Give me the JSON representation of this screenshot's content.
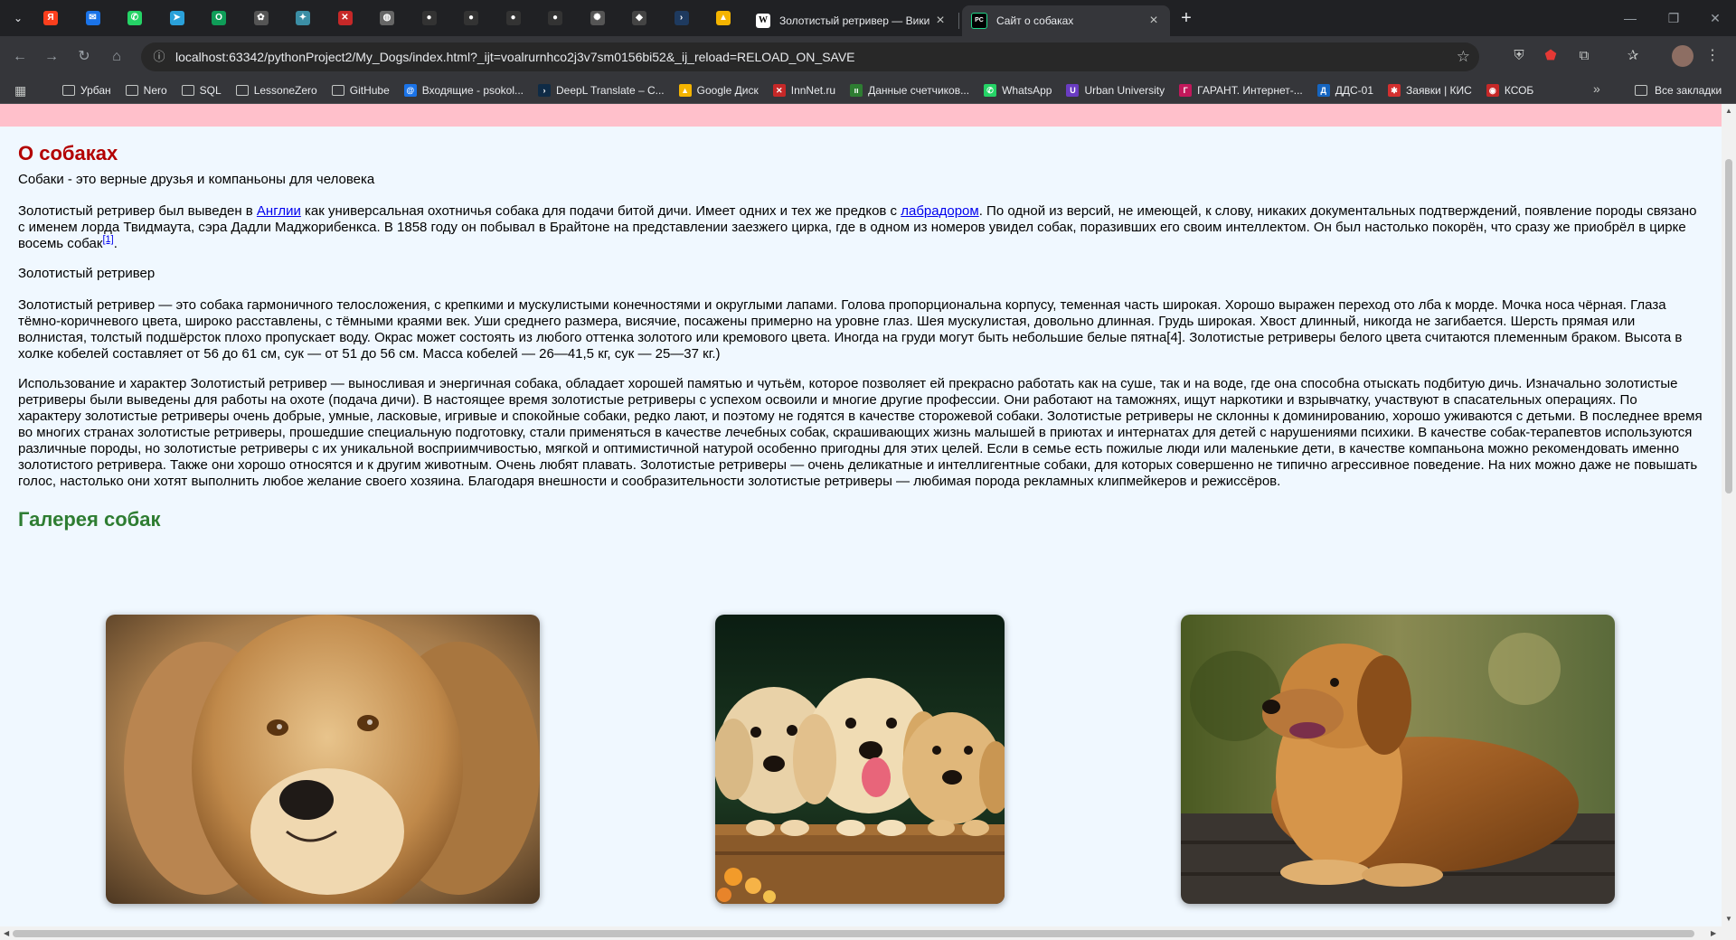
{
  "browser": {
    "pinned_tabs": [
      {
        "icon": "yandex-icon",
        "color": "#fc3f1d",
        "glyph": "Я"
      },
      {
        "icon": "mail-icon",
        "color": "#1a73e8",
        "glyph": "✉"
      },
      {
        "icon": "whatsapp-icon",
        "color": "#25d366",
        "glyph": "✆"
      },
      {
        "icon": "telegram-icon",
        "color": "#2aa1da",
        "glyph": "➤"
      },
      {
        "icon": "app-icon",
        "color": "#0f9d58",
        "glyph": "O"
      },
      {
        "icon": "plant-icon",
        "color": "#555555",
        "glyph": "✿"
      },
      {
        "icon": "puzzle-icon",
        "color": "#3b8ea5",
        "glyph": "✦"
      },
      {
        "icon": "innnet-icon",
        "color": "#c62828",
        "glyph": "✕"
      },
      {
        "icon": "globe-icon",
        "color": "#666666",
        "glyph": "◍"
      },
      {
        "icon": "github-icon",
        "color": "#333333",
        "glyph": "●"
      },
      {
        "icon": "github-icon",
        "color": "#333333",
        "glyph": "●"
      },
      {
        "icon": "github-icon",
        "color": "#333333",
        "glyph": "●"
      },
      {
        "icon": "github-icon",
        "color": "#333333",
        "glyph": "●"
      },
      {
        "icon": "openai-icon",
        "color": "#555555",
        "glyph": "✺"
      },
      {
        "icon": "ai-icon",
        "color": "#444444",
        "glyph": "◆"
      },
      {
        "icon": "powershell-icon",
        "color": "#1e3a5f",
        "glyph": "›"
      },
      {
        "icon": "google-drive-icon",
        "color": "#f4b400",
        "glyph": "▲"
      }
    ],
    "tabs": [
      {
        "title": "Золотистый ретривер — Вики",
        "icon_glyph": "W"
      },
      {
        "title": "Сайт о собаках",
        "icon_glyph": "PC"
      }
    ],
    "url": "localhost:63342/pythonProject2/My_Dogs/index.html?_ijt=voalrurnhco2j3v7sm0156bi52&_ij_reload=RELOAD_ON_SAVE",
    "bookmarks": [
      {
        "label": "Урбан",
        "type": "folder"
      },
      {
        "label": "Nero",
        "type": "folder"
      },
      {
        "label": "SQL",
        "type": "folder"
      },
      {
        "label": "LessoneZero",
        "type": "folder"
      },
      {
        "label": "GitHube",
        "type": "folder"
      },
      {
        "label": "Входящие - psokol...",
        "type": "site",
        "color": "#1a73e8",
        "glyph": "@"
      },
      {
        "label": "DeepL Translate – С...",
        "type": "site",
        "color": "#0f2b46",
        "glyph": "›"
      },
      {
        "label": "Google Диск",
        "type": "site",
        "color": "#f4b400",
        "glyph": "▲"
      },
      {
        "label": "InnNet.ru",
        "type": "site",
        "color": "#c62828",
        "glyph": "✕"
      },
      {
        "label": "Данные счетчиков...",
        "type": "site",
        "color": "#2e7d32",
        "glyph": "ıı"
      },
      {
        "label": "WhatsApp",
        "type": "site",
        "color": "#25d366",
        "glyph": "✆"
      },
      {
        "label": "Urban University",
        "type": "site",
        "color": "#6a3cc2",
        "glyph": "U"
      },
      {
        "label": "ГАРАНТ. Интернет-...",
        "type": "site",
        "color": "#c2185b",
        "glyph": "Г"
      },
      {
        "label": "ДДС-01",
        "type": "site",
        "color": "#1565c0",
        "glyph": "Д"
      },
      {
        "label": "Заявки | КИС",
        "type": "site",
        "color": "#d32f2f",
        "glyph": "✱"
      },
      {
        "label": "КСОБ",
        "type": "site",
        "color": "#c62828",
        "glyph": "◉"
      }
    ],
    "all_bookmarks_label": "Все закладки"
  },
  "page": {
    "title": "О собаках",
    "intro": "Собаки - это верные друзья и компаньоны для человека",
    "history": {
      "part1": "Золотистый ретривер был выведен в ",
      "link1": "Англии",
      "part2": " как универсальная охотничья собака для подачи битой дичи. Имеет одних и тех же предков с ",
      "link2": "лабрадором",
      "part3": ". По одной из версий, не имеющей, к слову, никаких документальных подтверждений, появление породы связано с именем лорда Твидмаута, сэра Дадли Маджорибенкса. В 1858 году он побывал в Брайтоне на представлении заезжего цирка, где в одном из номеров увидел собак, поразивших его своим интеллектом. Он был настолько покорён, что сразу же приобрёл в цирке восемь собак",
      "ref": "[1]",
      "part4": "."
    },
    "breed_heading": "Золотистый ретривер",
    "description": "Золотистый ретривер — это собака гармоничного телосложения, с крепкими и мускулистыми конечностями и округлыми лапами. Голова пропорциональна корпусу, теменная часть широкая. Хорошо выражен переход ото лба к морде. Мочка носа чёрная. Глаза тёмно-коричневого цвета, широко расставлены, с тёмными краями век. Уши среднего размера, висячие, посажены примерно на уровне глаз. Шея мускулистая, довольно длинная. Грудь широкая. Хвост длинный, никогда не загибается. Шерсть прямая или волнистая, толстый подшёрсток плохо пропускает воду. Окрас может состоять из любого оттенка золотого или кремового цвета. Иногда на груди могут быть небольшие белые пятна[4]. Золотистые ретриверы белого цвета считаются племенным браком. Высота в холке кобелей составляет от 56 до 61 см, сук — от 51 до 56 см. Масса кобелей — 26—41,5 кг, сук — 25—37 кг.)",
    "character": "Использование и характер Золотистый ретривер — выносливая и энергичная собака, обладает хорошей памятью и чутьём, которое позволяет ей прекрасно работать как на суше, так и на воде, где она способна отыскать подбитую дичь. Изначально золотистые ретриверы были выведены для работы на охоте (подача дичи). В настоящее время золотистые ретриверы с успехом освоили и многие другие профессии. Они работают на таможнях, ищут наркотики и взрывчатку, участвуют в спасательных операциях. По характеру золотистые ретриверы очень добрые, умные, ласковые, игривые и спокойные собаки, редко лают, и поэтому не годятся в качестве сторожевой собаки. Золотистые ретриверы не склонны к доминированию, хорошо уживаются с детьми. В последнее время во многих странах золотистые ретриверы, прошедшие специальную подготовку, стали применяться в качестве лечебных собак, скрашивающих жизнь малышей в приютах и интернатах для детей с нарушениями психики. В качестве собак-терапевтов используются различные породы, но золотистые ретриверы с их уникальной восприимчивостью, мягкой и оптимистичной натурой особенно пригодны для этих целей. Если в семье есть пожилые люди или маленькие дети, в качестве компаньона можно рекомендовать именно золотистого ретривера. Также они хорошо относятся и к другим животным. Очень любят плавать. Золотистые ретриверы — очень деликатные и интеллигентные собаки, для которых совершенно не типично агрессивное поведение. На них можно даже не повышать голос, настолько они хотят выполнить любое желание своего хозяина. Благодаря внешности и сообразительности золотистые ретриверы — любимая порода рекламных клипмейкеров и режиссёров.",
    "gallery_title": "Галерея собак",
    "colors": {
      "title": "#b30000",
      "gallery_title": "#2e7d32",
      "top_bar": "#ffc0cb",
      "background": "#f0f8ff"
    }
  }
}
